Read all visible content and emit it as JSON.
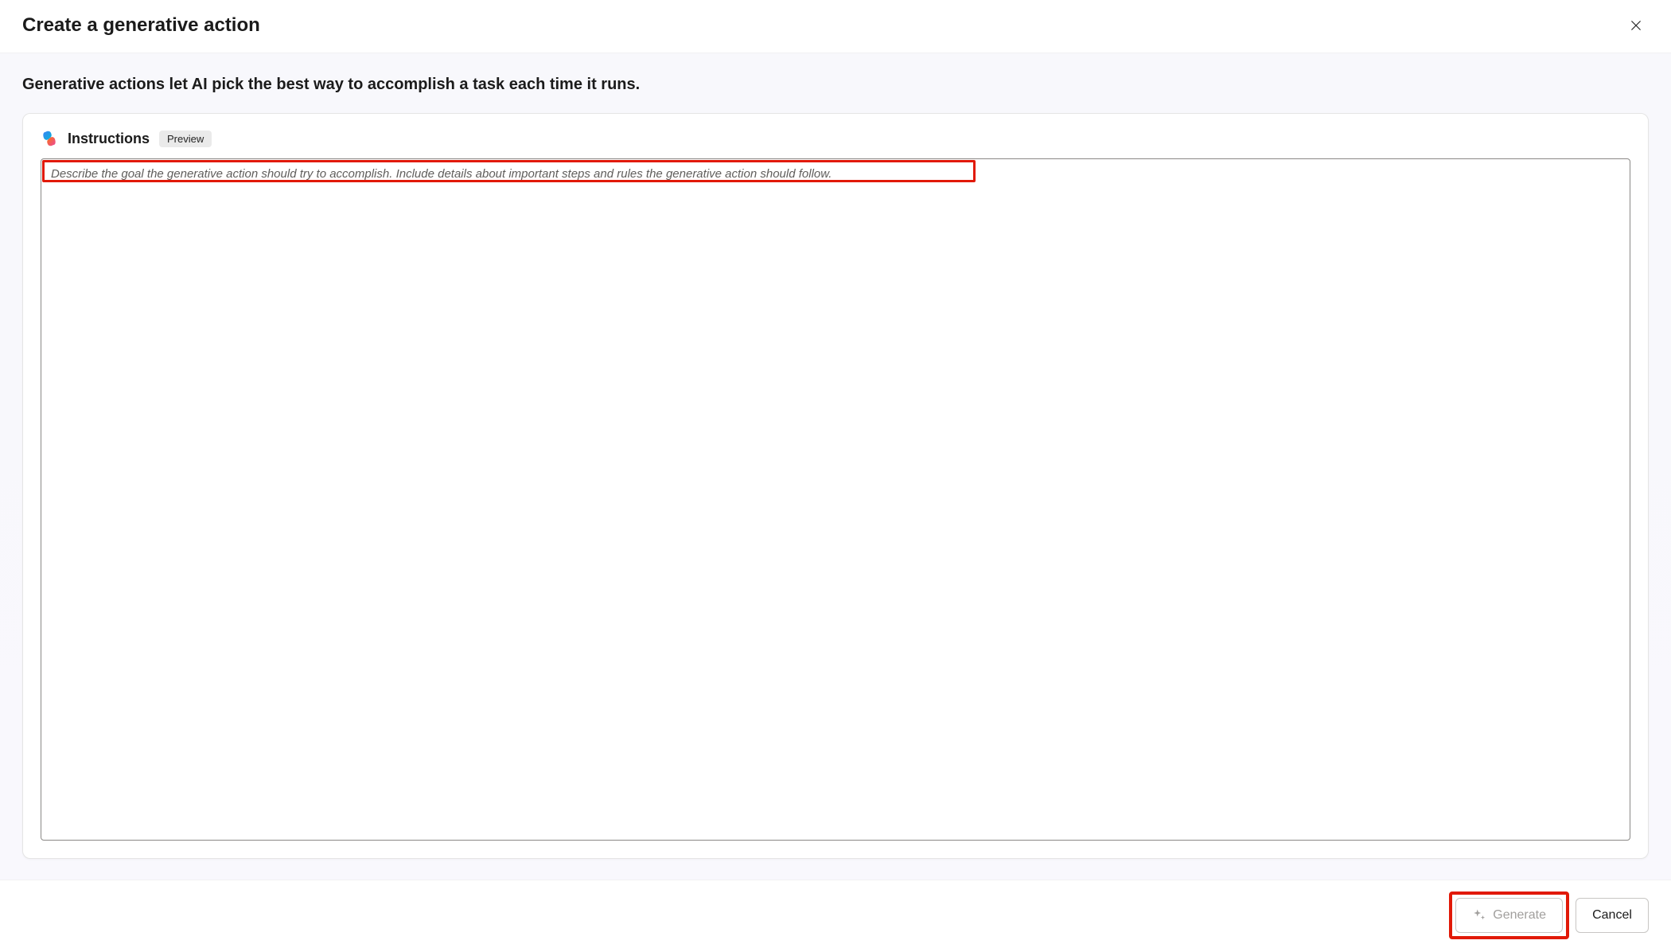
{
  "dialog": {
    "title": "Create a generative action",
    "close_aria": "Close"
  },
  "description": "Generative actions let AI pick the best way to accomplish a task each time it runs.",
  "instructions": {
    "logo_name": "copilot-logo-icon",
    "title": "Instructions",
    "badge": "Preview",
    "placeholder": "Describe the goal the generative action should try to accomplish. Include details about important steps and rules the generative action should follow.",
    "value": ""
  },
  "footer": {
    "generate_label": "Generate",
    "generate_disabled": true,
    "cancel_label": "Cancel"
  }
}
